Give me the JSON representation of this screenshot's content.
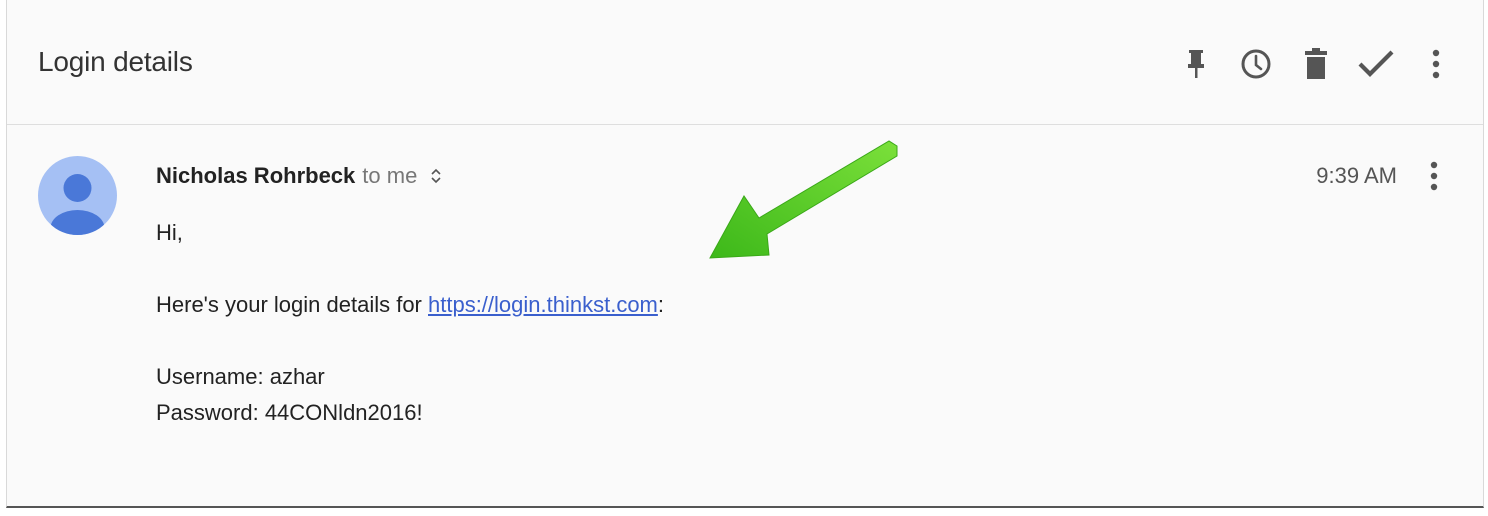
{
  "thread": {
    "subject": "Login details",
    "toolbar": {
      "pin_icon": "pin-icon",
      "snooze_icon": "clock-icon",
      "delete_icon": "trash-icon",
      "done_icon": "check-icon",
      "more_icon": "more-vert-icon"
    }
  },
  "message": {
    "sender": "Nicholas Rohrbeck",
    "recipient": "to me",
    "time": "9:39 AM",
    "greeting": "Hi,",
    "line1_prefix": "Here's your login details for ",
    "link": "https://login.thinkst.com",
    "line1_suffix": ":",
    "username_line": "Username: azhar",
    "password_line": "Password: 44CONldn2016!"
  },
  "colors": {
    "link": "#3a5fcd",
    "avatar_bg": "#a5c0f4",
    "avatar_fg": "#4a78d8",
    "arrow": "#55cc22"
  }
}
